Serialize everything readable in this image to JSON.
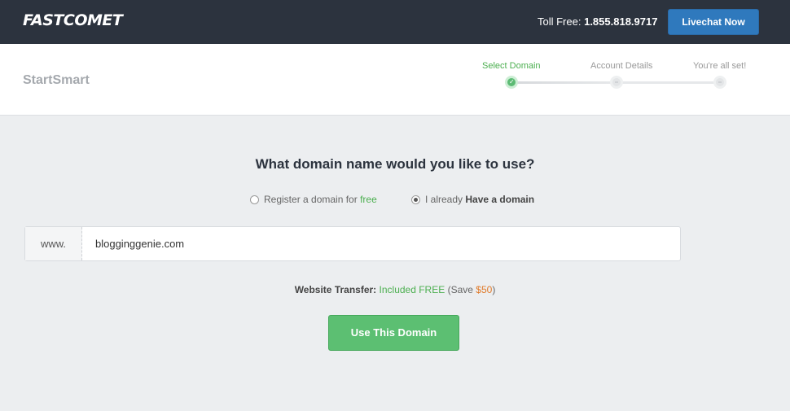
{
  "topbar": {
    "logo": "FASTCOMET",
    "toll_label": "Toll Free:",
    "toll_number": "1.855.818.9717",
    "livechat_label": "Livechat Now"
  },
  "header": {
    "brand": "StartSmart",
    "steps": [
      {
        "label": "Select Domain",
        "state": "active"
      },
      {
        "label": "Account Details",
        "state": "pending"
      },
      {
        "label": "You're all set!",
        "state": "pending"
      }
    ]
  },
  "main": {
    "question": "What domain name would you like to use?",
    "option_register": {
      "prefix": "Register a domain for",
      "highlight": "free",
      "selected": false
    },
    "option_have": {
      "prefix": "I already",
      "bold": "Have a domain",
      "selected": true
    },
    "domain_prefix": "www.",
    "domain_value": "blogginggenie.com",
    "transfer": {
      "label": "Website Transfer:",
      "included": "Included FREE",
      "save_prefix": "(Save",
      "save_amount": "$50",
      "save_suffix": ")"
    },
    "submit_label": "Use This Domain"
  },
  "colors": {
    "topbar_bg": "#2c333e",
    "livechat_bg": "#2f79bd",
    "accent_green": "#4caf50",
    "button_green": "#5cbf72",
    "save_orange": "#e07a2a"
  }
}
